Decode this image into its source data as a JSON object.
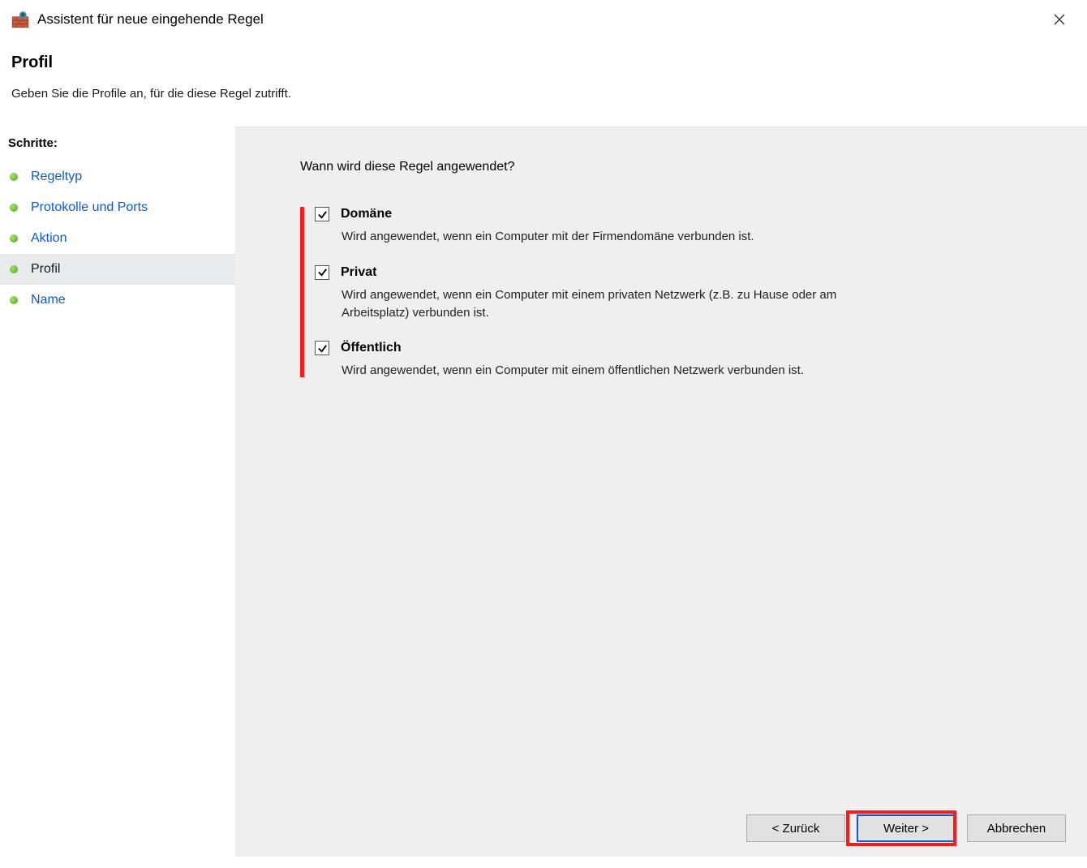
{
  "window": {
    "title": "Assistent für neue eingehende Regel"
  },
  "header": {
    "title": "Profil",
    "description": "Geben Sie die Profile an, für die diese Regel zutrifft."
  },
  "sidebar": {
    "title": "Schritte:",
    "steps": [
      {
        "label": "Regeltyp",
        "current": false
      },
      {
        "label": "Protokolle und Ports",
        "current": false
      },
      {
        "label": "Aktion",
        "current": false
      },
      {
        "label": "Profil",
        "current": true
      },
      {
        "label": "Name",
        "current": false
      }
    ]
  },
  "main": {
    "question": "Wann wird diese Regel angewendet?",
    "options": [
      {
        "label": "Domäne",
        "checked": true,
        "description": "Wird angewendet, wenn ein Computer mit der Firmendomäne verbunden ist."
      },
      {
        "label": "Privat",
        "checked": true,
        "description": "Wird angewendet, wenn ein Computer mit einem privaten Netzwerk (z.B. zu Hause oder am Arbeitsplatz) verbunden ist."
      },
      {
        "label": "Öffentlich",
        "checked": true,
        "description": "Wird angewendet, wenn ein Computer mit einem öffentlichen Netzwerk verbunden ist."
      }
    ]
  },
  "buttons": {
    "back": "< Zurück",
    "next": "Weiter >",
    "cancel": "Abbrechen"
  }
}
